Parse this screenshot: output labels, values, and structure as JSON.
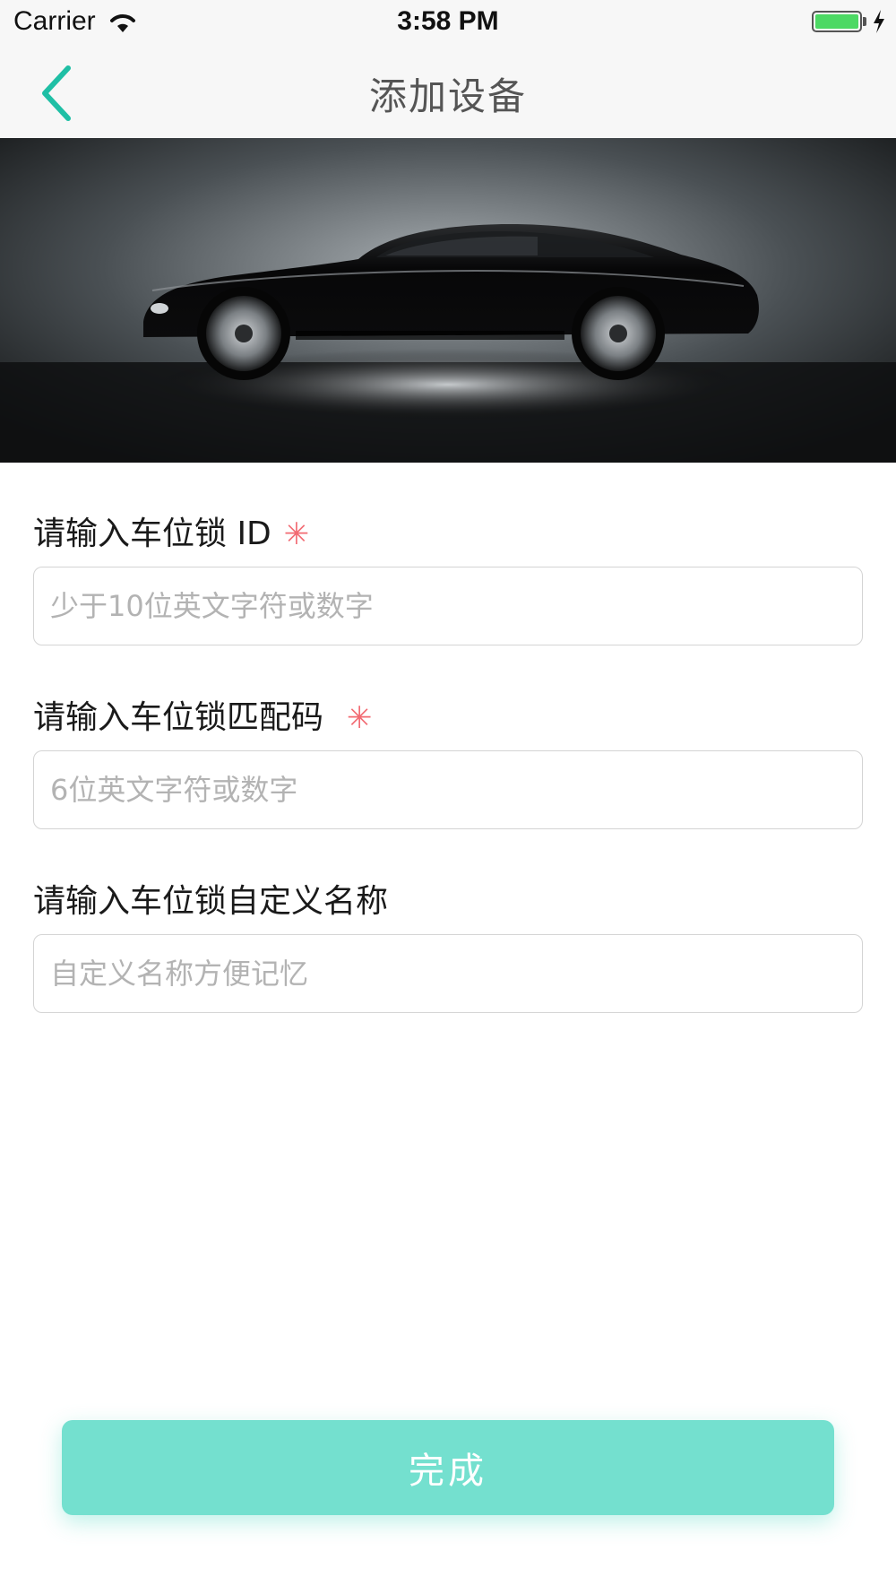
{
  "status_bar": {
    "carrier": "Carrier",
    "time": "3:58 PM",
    "battery_color": "#4cd964"
  },
  "nav": {
    "title": "添加设备",
    "back_icon": "chevron-left-icon",
    "accent_color": "#1fbfa5"
  },
  "banner": {
    "image": "black sports car on dark gradient background"
  },
  "form": {
    "fields": [
      {
        "label": "请输入车位锁 ID",
        "required": "✳",
        "placeholder": "少于10位英文字符或数字",
        "value": ""
      },
      {
        "label": "请输入车位锁匹配码",
        "required": "✳",
        "placeholder": "6位英文字符或数字",
        "value": ""
      },
      {
        "label": "请输入车位锁自定义名称",
        "placeholder": "自定义名称方便记忆",
        "value": ""
      }
    ]
  },
  "submit": {
    "label": "完成",
    "color": "#74e0cf"
  }
}
